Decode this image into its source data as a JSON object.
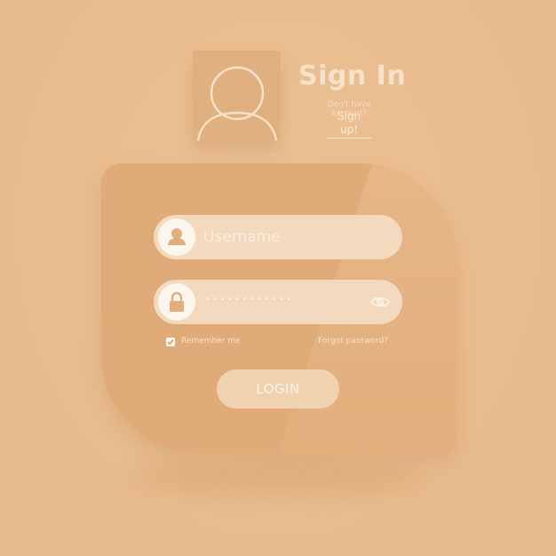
{
  "header": {
    "title": "Sign In",
    "subtitle": "Don't have account?",
    "signup_link": "Sign up!"
  },
  "form": {
    "username": {
      "placeholder": "Username",
      "value": "",
      "icon": "user-icon"
    },
    "password": {
      "masked_value": "••••••••••••",
      "icon": "lock-icon",
      "toggle_icon": "eye-icon"
    },
    "remember_me": {
      "label": "Remember me",
      "checked": true
    },
    "forgot_password": "Forgot password?",
    "login_button": "LOGIN"
  },
  "avatar": {
    "icon": "avatar-icon"
  },
  "colors": {
    "background": "#e8bb8c",
    "panel": "#e0ab78",
    "field": "#f3d9bd",
    "icon_circle": "#fdf6ee",
    "text_light": "#f6e2cb"
  }
}
